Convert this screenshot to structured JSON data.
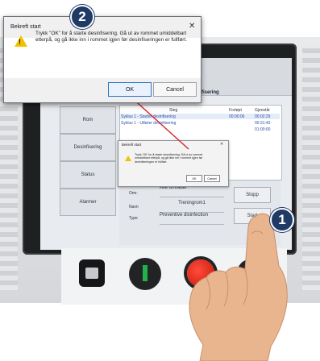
{
  "device_screen": {
    "header_title": "esinfisering",
    "menu": {
      "room": "Rom",
      "disinfection": "Desinfisering",
      "status": "Status",
      "alarms": "Alarmer"
    },
    "table": {
      "headers": {
        "step": "Steg",
        "elapsed": "Forløpt",
        "remaining": "Gjenstår"
      },
      "rows": [
        {
          "step": "Syklus 1 - Starter desinfisering",
          "elapsed": "00:00:06",
          "remaining": "00:02:29"
        },
        {
          "step": "Syklus 1 - Utfører desinfisering",
          "elapsed": "",
          "remaining": "00:31:43"
        },
        {
          "step": "",
          "elapsed": "",
          "remaining": "01:00:00"
        }
      ]
    },
    "info": {
      "area_label": "Omr.",
      "area_value": "Alle områder",
      "name_label": "Navn",
      "name_value": "Treningrom1",
      "type_label": "Type",
      "type_value": "Preventive disinfection"
    },
    "buttons": {
      "stop": "Stopp",
      "start": "Start"
    },
    "mini_dialog": {
      "title": "Bekreft start",
      "close": "✕",
      "message": "Trykk 'OK' for å starte desinfisering. Gå ut av rommet umiddelbart etterpå, og gå ikke inn i rommet igjen før desinfiseringen er fullført.",
      "ok": "OK",
      "cancel": "Cancel"
    }
  },
  "dialog": {
    "title": "Bekreft start",
    "close": "✕",
    "message": "Trykk \"OK\" for å starte desinfisering. Gå ut av rommet umiddelbart etterpå, og gå ikke inn i rommet igjen før desinfiseringen er fullført.",
    "ok": "OK",
    "cancel": "Cancel",
    "warning_mark": "!"
  },
  "badges": {
    "step1": "1",
    "step2": "2"
  },
  "colors": {
    "badge": "#1f3a64",
    "connector": "#d9242a",
    "stop_button": "#d8231a",
    "key_indicator": "#23b04a",
    "warning": "#f2c200"
  }
}
